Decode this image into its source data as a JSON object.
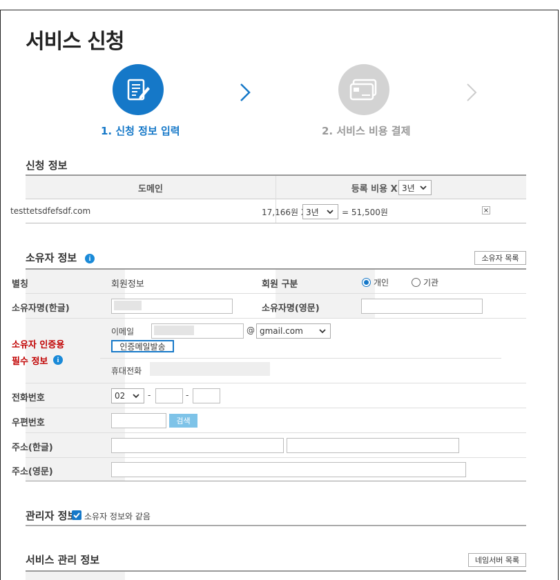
{
  "page": {
    "title": "서비스 신청"
  },
  "steps": [
    {
      "label": "1. 신청 정보 입력",
      "active": true
    },
    {
      "label": "2. 서비스 비용 결제",
      "active": false
    }
  ],
  "apply_info": {
    "title": "신청 정보",
    "col_domain": "도메인",
    "col_fee": "등록 비용 X 기간:",
    "period_select": "3년",
    "domain": "testtetsdfefsdf.com",
    "unit_price": "17,166원 X",
    "row_period": "3년",
    "total": "= 51,500원",
    "remove_glyph": "×"
  },
  "owner": {
    "title": "소유자 정보",
    "list_button": "소유자 목록",
    "alias_label": "별칭",
    "alias_value": "회원정보",
    "member_type_label": "회원 구분",
    "member_types": [
      "개인",
      "기관"
    ],
    "name_ko_label": "소유자명(한글)",
    "name_en_label": "소유자명(영문)",
    "auth_label_1": "소유자 인증용",
    "auth_label_2": "필수 정보",
    "email_label": "이메일",
    "at": "@",
    "email_domain": "gmail.com",
    "send_mail_button": "인증메일발송",
    "mobile_label": "휴대전화",
    "phone_label": "전화번호",
    "phone_area": "02",
    "dash": "-",
    "zip_label": "우편번호",
    "search_button": "검색",
    "addr_ko_label": "주소(한글)",
    "addr_en_label": "주소(영문)"
  },
  "admin": {
    "title": "관리자 정보",
    "same_as_owner": "소유자 정보와 같음",
    "same_checked": true
  },
  "service": {
    "title": "서비스 관리 정보",
    "ns_button": "네임서버 목록"
  },
  "colors": {
    "accent": "#1578c8",
    "required": "#c00000",
    "search_btn": "#7ec3e8"
  }
}
